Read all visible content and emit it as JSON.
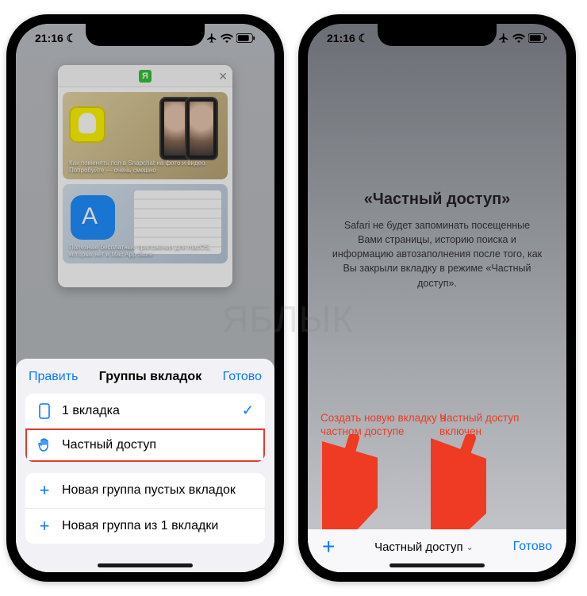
{
  "status": {
    "time": "21:16",
    "moon": "☾"
  },
  "watermark": "ЯБЛЫК",
  "left": {
    "preview": {
      "favicon_letter": "Я",
      "card1_text": "Как поменять пол в Snapchat на фото и видео. Попробуйте — очень смешно",
      "card2_text": "Полезные бесплатные приложения для macOS, которых нет в Mac App Store"
    },
    "sheet": {
      "edit": "Править",
      "title": "Группы вкладок",
      "done": "Готово",
      "rows": {
        "tabs": "1 вкладка",
        "private": "Частный доступ",
        "new_empty": "Новая группа пустых вкладок",
        "new_from": "Новая группа из 1 вкладки"
      }
    }
  },
  "right": {
    "title": "«Частный доступ»",
    "body": "Safari не будет запоминать посещенные Вами страницы, историю поиска и информацию автозаполнения после того, как Вы закрыли вкладку в режиме «Частный доступ».",
    "annotations": {
      "create": "Создать новую вкладку в частном доступе",
      "enabled": "Частный доступ включен"
    },
    "toolbar": {
      "mode": "Частный доступ",
      "done": "Готово"
    }
  }
}
